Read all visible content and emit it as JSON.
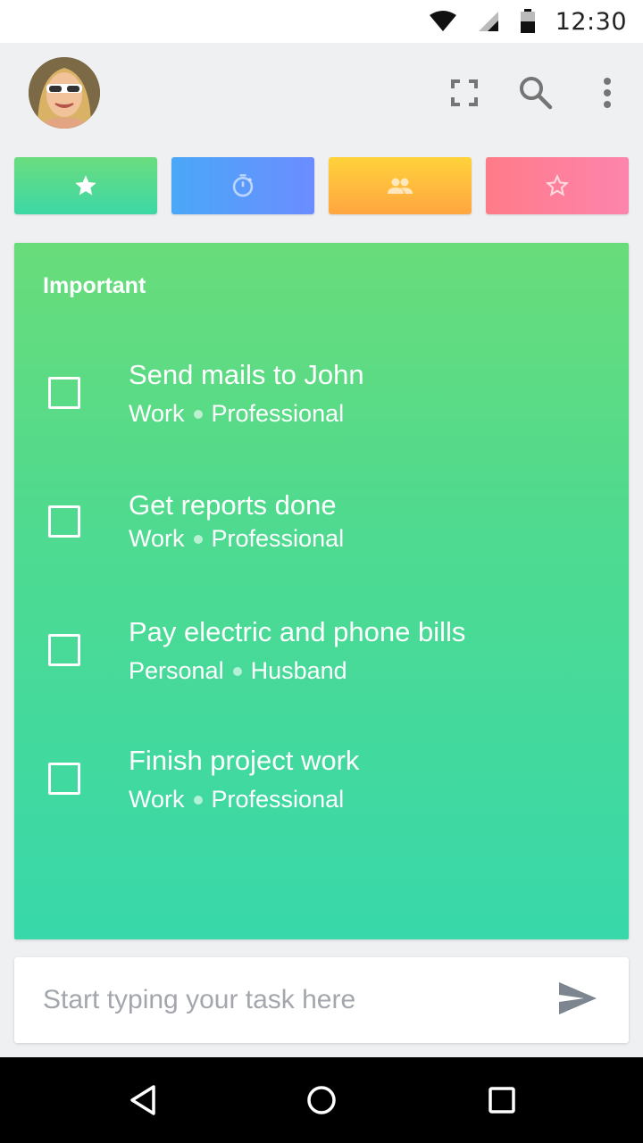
{
  "status_bar": {
    "time": "12:30",
    "icons": [
      "wifi-icon",
      "signal-icon",
      "battery-icon"
    ]
  },
  "header": {
    "avatar_icon": "user-avatar",
    "actions": [
      "expand-icon",
      "search-icon",
      "more-vert-icon"
    ]
  },
  "category_tabs": [
    {
      "name": "important",
      "icon": "star-filled-icon",
      "color": "#4fd98a"
    },
    {
      "name": "timer",
      "icon": "timer-icon",
      "color": "#5a9cfa"
    },
    {
      "name": "people",
      "icon": "people-icon",
      "color": "#ffbd3e"
    },
    {
      "name": "favorites",
      "icon": "star-outline-icon",
      "color": "#fe80a0"
    }
  ],
  "card": {
    "title": "Important",
    "tasks": [
      {
        "title": "Send mails to John",
        "category": "Work",
        "tag": "Professional"
      },
      {
        "title": "Get reports done",
        "category": "Work",
        "tag": "Professional"
      },
      {
        "title": "Pay electric and phone bills",
        "category": "Personal",
        "tag": "Husband"
      },
      {
        "title": "Finish project work",
        "category": "Work",
        "tag": "Professional"
      }
    ]
  },
  "input": {
    "placeholder": "Start typing your task here",
    "value": "",
    "send_icon": "send-icon"
  },
  "nav_bar": {
    "buttons": [
      "back-icon",
      "home-icon",
      "recents-icon"
    ]
  }
}
